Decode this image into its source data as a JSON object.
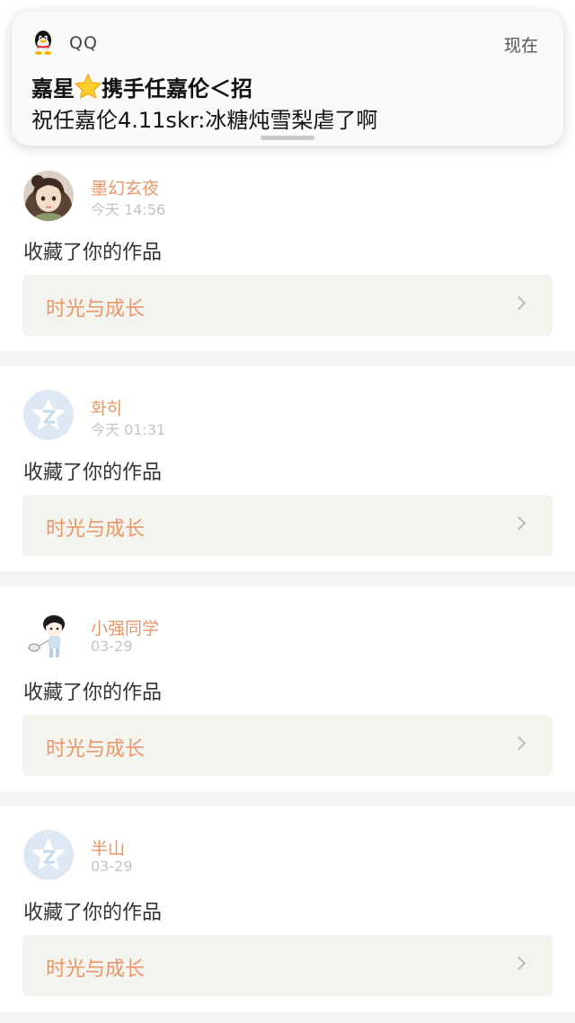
{
  "notification": {
    "app_name": "QQ",
    "time": "现在",
    "title": "嘉星",
    "title_emoji": "star-emoji",
    "title_rest": "携手任嘉伦＜招",
    "body": "祝任嘉伦4.11skr:冰糖炖雪梨虐了啊"
  },
  "feed": [
    {
      "user": "墨幻玄夜",
      "time": "今天 14:56",
      "action": "收藏了你的作品",
      "work": "时光与成长",
      "avatar": "anime-girl-avatar"
    },
    {
      "user": "화히",
      "time": "今天 01:31",
      "action": "收藏了你的作品",
      "work": "时光与成长",
      "avatar": "default-qzone-avatar"
    },
    {
      "user": "小强同学",
      "time": "03-29",
      "action": "收藏了你的作品",
      "work": "时光与成长",
      "avatar": "cartoon-boy-avatar"
    },
    {
      "user": "半山",
      "time": "03-29",
      "action": "收藏了你的作品",
      "work": "时光与成长",
      "avatar": "default-qzone-avatar"
    }
  ],
  "colors": {
    "accent": "#e8966a",
    "time_gray": "#c4c4c4",
    "work_box_bg": "#f4f4ee",
    "page_bg": "#f5f5f5"
  }
}
